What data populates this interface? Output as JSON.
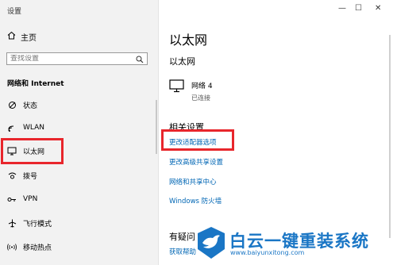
{
  "window": {
    "title": "设置",
    "minimize": "—",
    "maximize": "☐",
    "close": "✕"
  },
  "sidebar": {
    "home_label": "主页",
    "search_placeholder": "查找设置",
    "section_title": "网络和 Internet",
    "items": [
      {
        "label": "状态",
        "icon": "status-icon"
      },
      {
        "label": "WLAN",
        "icon": "wifi-icon"
      },
      {
        "label": "以太网",
        "icon": "ethernet-icon"
      },
      {
        "label": "拨号",
        "icon": "dialup-icon"
      },
      {
        "label": "VPN",
        "icon": "vpn-icon"
      },
      {
        "label": "飞行模式",
        "icon": "airplane-icon"
      },
      {
        "label": "移动热点",
        "icon": "hotspot-icon"
      }
    ],
    "selected": "以太网"
  },
  "main": {
    "page_title": "以太网",
    "sub_title": "以太网",
    "network": {
      "name": "网络 4",
      "status": "已连接"
    },
    "related_title": "相关设置",
    "related_links": [
      "更改适配器选项",
      "更改高级共享设置",
      "网络和共享中心",
      "Windows 防火墙"
    ],
    "help_title": "有疑问",
    "help_link": "获取帮助"
  },
  "watermark": {
    "text": "白云一键重装系统",
    "url": "www.baiyunxitong.com"
  },
  "colors": {
    "accent": "#0066b4",
    "highlight_box": "#e8262c",
    "sidebar_bg": "#f2f2f2",
    "watermark": "#1a76c5"
  }
}
